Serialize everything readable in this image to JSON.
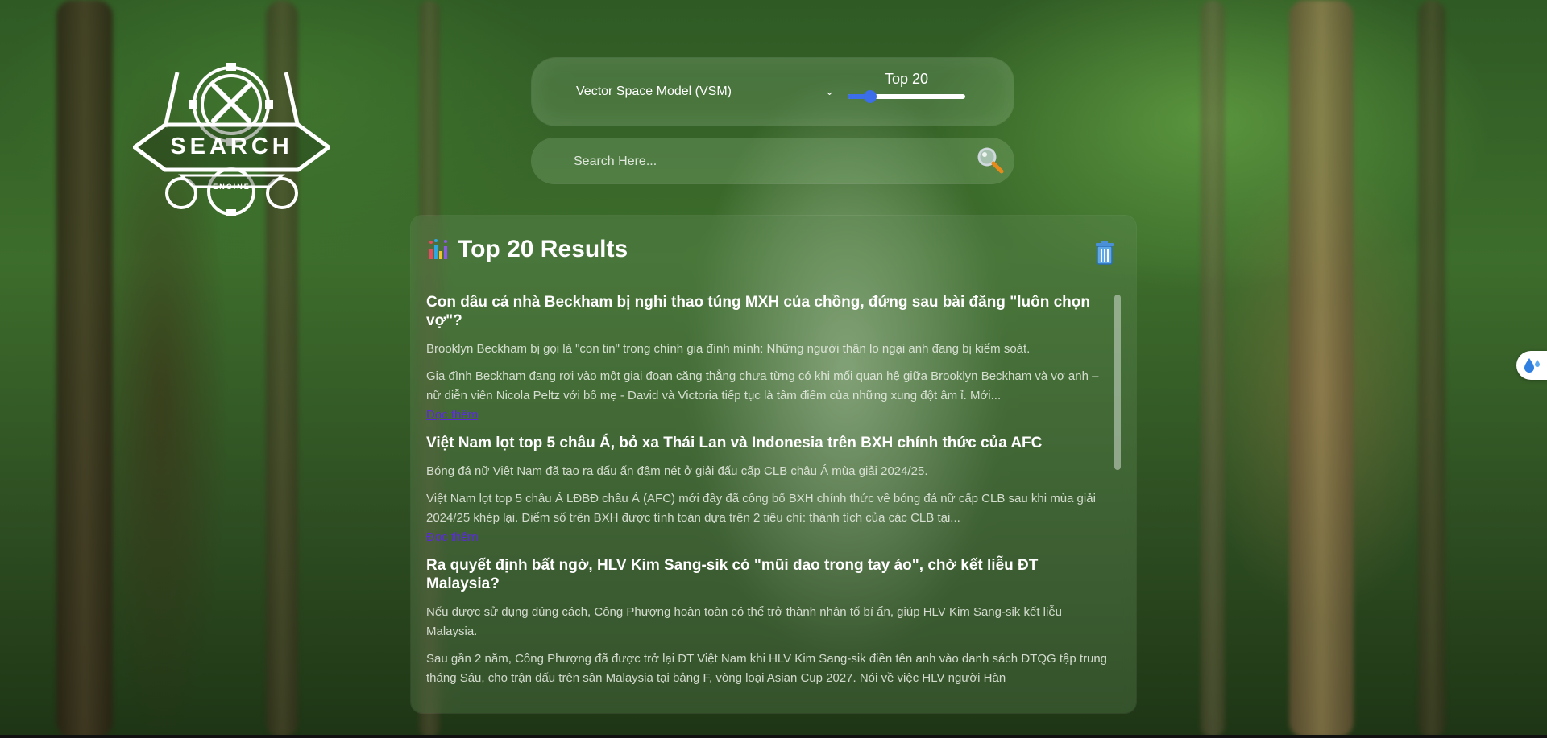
{
  "logo": {
    "title": "SEARCH",
    "subtitle": "ENGINE"
  },
  "controls": {
    "model_selected": "Vector Space Model (VSM)",
    "topk_label": "Top 20",
    "topk_value_fraction": 0.2
  },
  "search": {
    "placeholder": "Search Here...",
    "value": ""
  },
  "results": {
    "title": "Top 20 Results",
    "items": [
      {
        "title": "Con dâu cả nhà Beckham bị nghi thao túng MXH của chồng, đứng sau bài đăng \"luôn chọn vợ\"?",
        "summary": "Brooklyn Beckham bị gọi là \"con tin\" trong chính gia đình mình: Những người thân lo ngại anh đang bị kiểm soát.",
        "body": "Gia đình Beckham đang rơi vào một giai đoạn căng thẳng chưa từng có khi mối quan hệ giữa Brooklyn Beckham và vợ anh – nữ diễn viên Nicola Peltz với bố mẹ - David và Victoria tiếp tục là tâm điểm của những xung đột âm ỉ. Mới...",
        "read_more": "Đọc thêm"
      },
      {
        "title": "Việt Nam lọt top 5 châu Á, bỏ xa Thái Lan và Indonesia trên BXH chính thức của AFC",
        "summary": "Bóng đá nữ Việt Nam đã tạo ra dấu ấn đậm nét ở giải đấu cấp CLB châu Á mùa giải 2024/25.",
        "body": "Việt Nam lọt top 5 châu Á LĐBĐ châu Á (AFC) mới đây đã công bố BXH chính thức về bóng đá nữ cấp CLB sau khi mùa giải 2024/25 khép lại. Điểm số trên BXH được tính toán dựa trên 2 tiêu chí: thành tích của các CLB tại...",
        "read_more": "Đọc thêm"
      },
      {
        "title": "Ra quyết định bất ngờ, HLV Kim Sang-sik có \"mũi dao trong tay áo\", chờ kết liễu ĐT Malaysia?",
        "summary": "Nếu được sử dụng đúng cách, Công Phượng hoàn toàn có thể trở thành nhân tố bí ẩn, giúp HLV Kim Sang-sik kết liễu Malaysia.",
        "body": "Sau gần 2 năm, Công Phượng đã được trở lại ĐT Việt Nam khi HLV Kim Sang-sik điền tên anh vào danh sách ĐTQG tập trung tháng Sáu, cho trận đấu trên sân Malaysia tại bảng F, vòng loại Asian Cup 2027. Nói về việc HLV người Hàn",
        "read_more": ""
      }
    ]
  },
  "icons": {
    "logo": "gear-wrench-emblem-icon",
    "select_chevron": "chevron-down-icon",
    "search": "magnifier-icon",
    "results": "bar-chart-icon",
    "clear": "trash-icon",
    "side": "water-drop-icon"
  },
  "colors": {
    "slider_accent": "#3b6ee8",
    "link": "#5a2bd8",
    "text": "#ffffff"
  }
}
